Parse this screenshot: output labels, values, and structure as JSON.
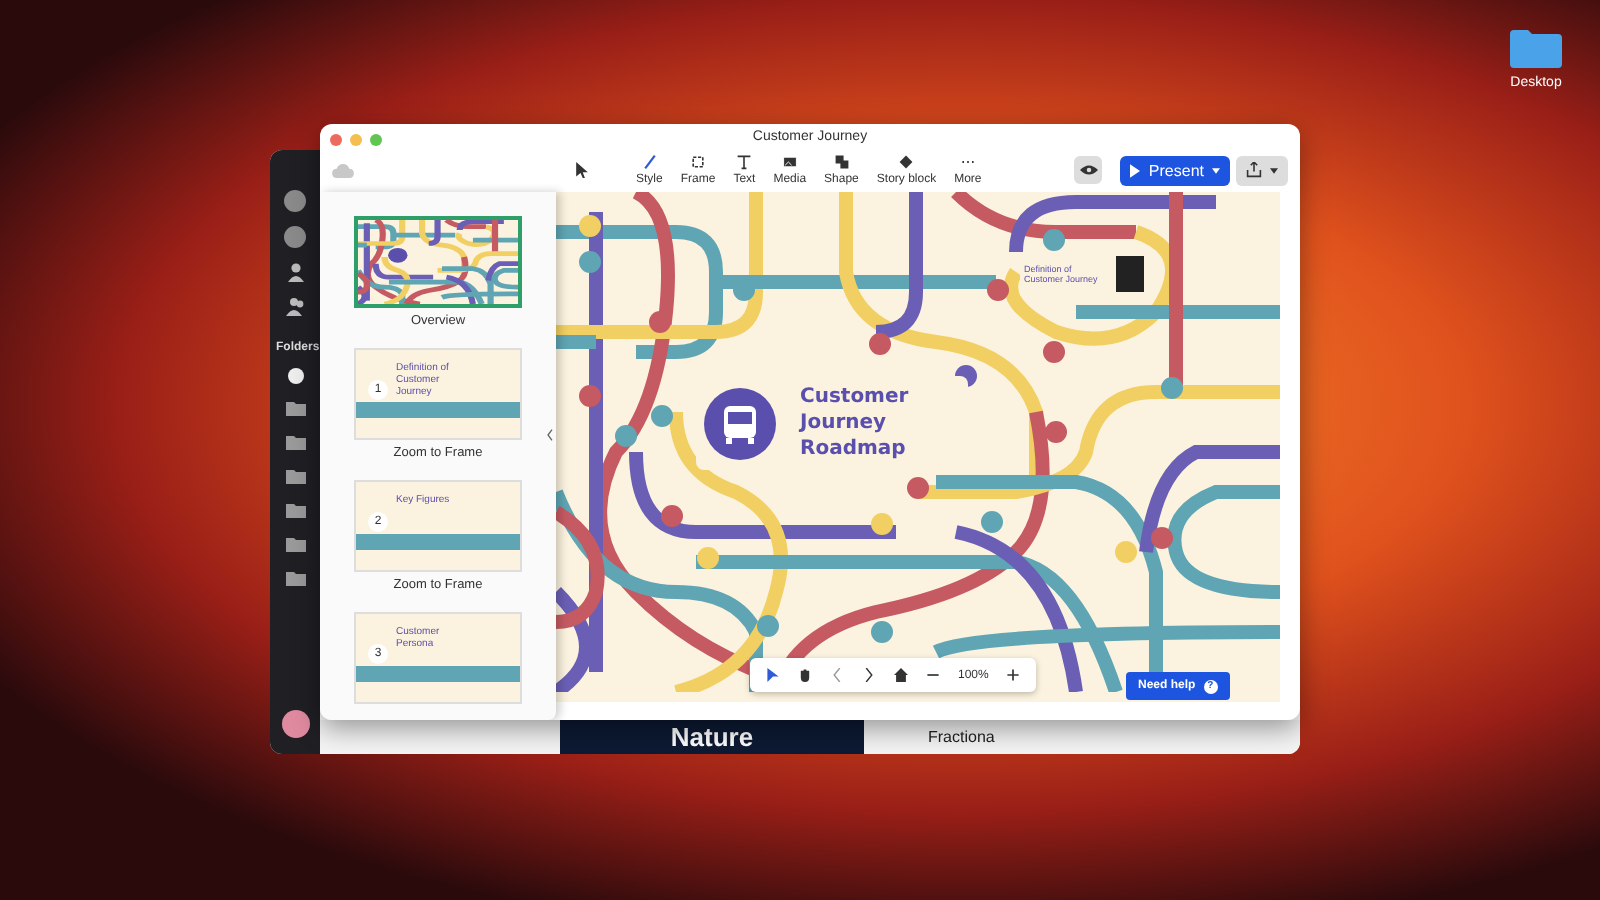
{
  "desktop": {
    "folder_label": "Desktop"
  },
  "back_window": {
    "sidebar_heading": "Folders",
    "strip_title": "Nature",
    "strip_text": "Fractiona"
  },
  "window": {
    "title": "Customer Journey"
  },
  "toolbar": {
    "tools": [
      {
        "label": "Style",
        "kind": "style"
      },
      {
        "label": "Frame",
        "kind": "frame"
      },
      {
        "label": "Text",
        "kind": "text"
      },
      {
        "label": "Media",
        "kind": "media"
      },
      {
        "label": "Shape",
        "kind": "shape"
      },
      {
        "label": "Story block",
        "kind": "story"
      },
      {
        "label": "More",
        "kind": "more"
      }
    ],
    "present_label": "Present"
  },
  "frames_panel": {
    "items": [
      {
        "kind": "overview",
        "label": "Overview",
        "selected": true
      },
      {
        "kind": "frame",
        "label": "Zoom to Frame",
        "number": "1",
        "title": "Definition of Customer Journey",
        "selected": false
      },
      {
        "kind": "frame",
        "label": "Zoom to Frame",
        "number": "2",
        "title": "Key Figures",
        "selected": false
      },
      {
        "kind": "frame",
        "number": "3",
        "title": "Customer Persona",
        "selected": false
      }
    ]
  },
  "canvas": {
    "title": "Customer Journey Roadmap",
    "frame_caption": "Definition of Customer Journey"
  },
  "bottom_bar": {
    "zoom": "100%"
  },
  "help_button": "Need help",
  "help_icon": "?"
}
